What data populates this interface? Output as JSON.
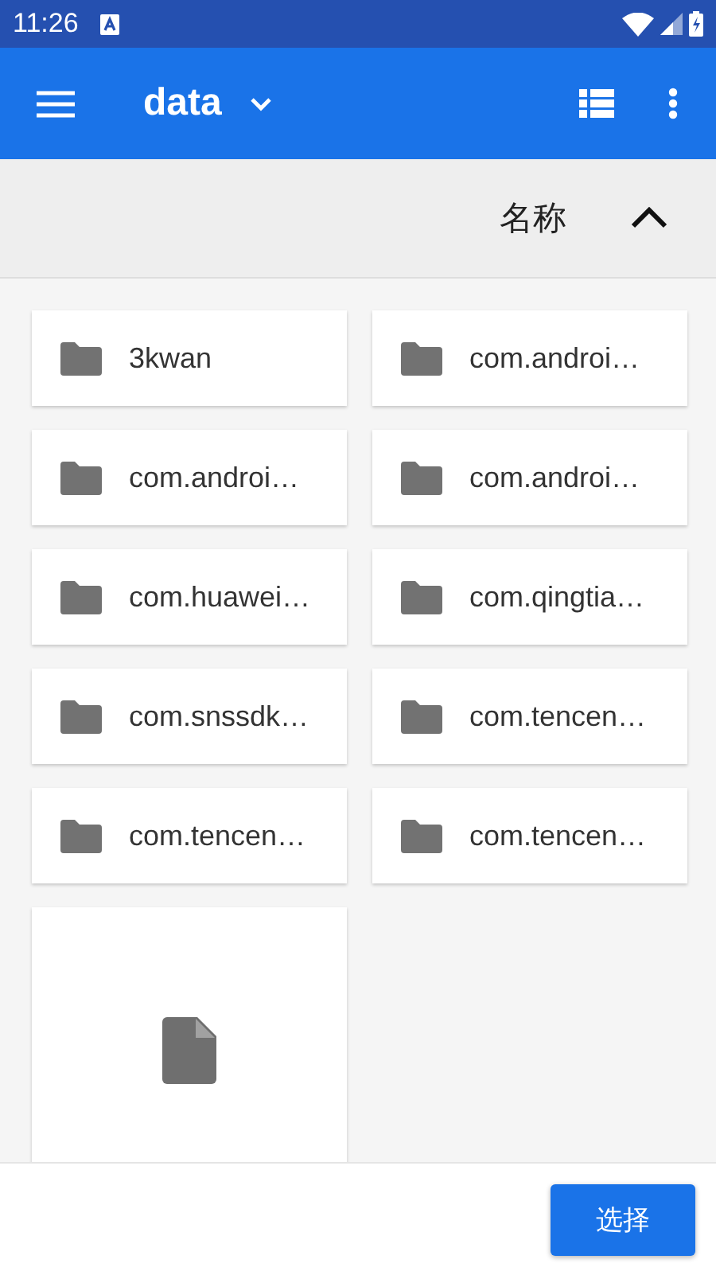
{
  "status_bar": {
    "time": "11:26"
  },
  "app_bar": {
    "title": "data"
  },
  "sort": {
    "label": "名称",
    "ascending": true
  },
  "items": [
    {
      "kind": "folder",
      "name": "3kwan"
    },
    {
      "kind": "folder",
      "name": "com.androi…"
    },
    {
      "kind": "folder",
      "name": "com.androi…"
    },
    {
      "kind": "folder",
      "name": "com.androi…"
    },
    {
      "kind": "folder",
      "name": "com.huawei…"
    },
    {
      "kind": "folder",
      "name": "com.qingtia…"
    },
    {
      "kind": "folder",
      "name": "com.snssdk…"
    },
    {
      "kind": "folder",
      "name": "com.tencen…"
    },
    {
      "kind": "folder",
      "name": "com.tencen…"
    },
    {
      "kind": "folder",
      "name": "com.tencen…"
    },
    {
      "kind": "file"
    }
  ],
  "select_button": "选择"
}
